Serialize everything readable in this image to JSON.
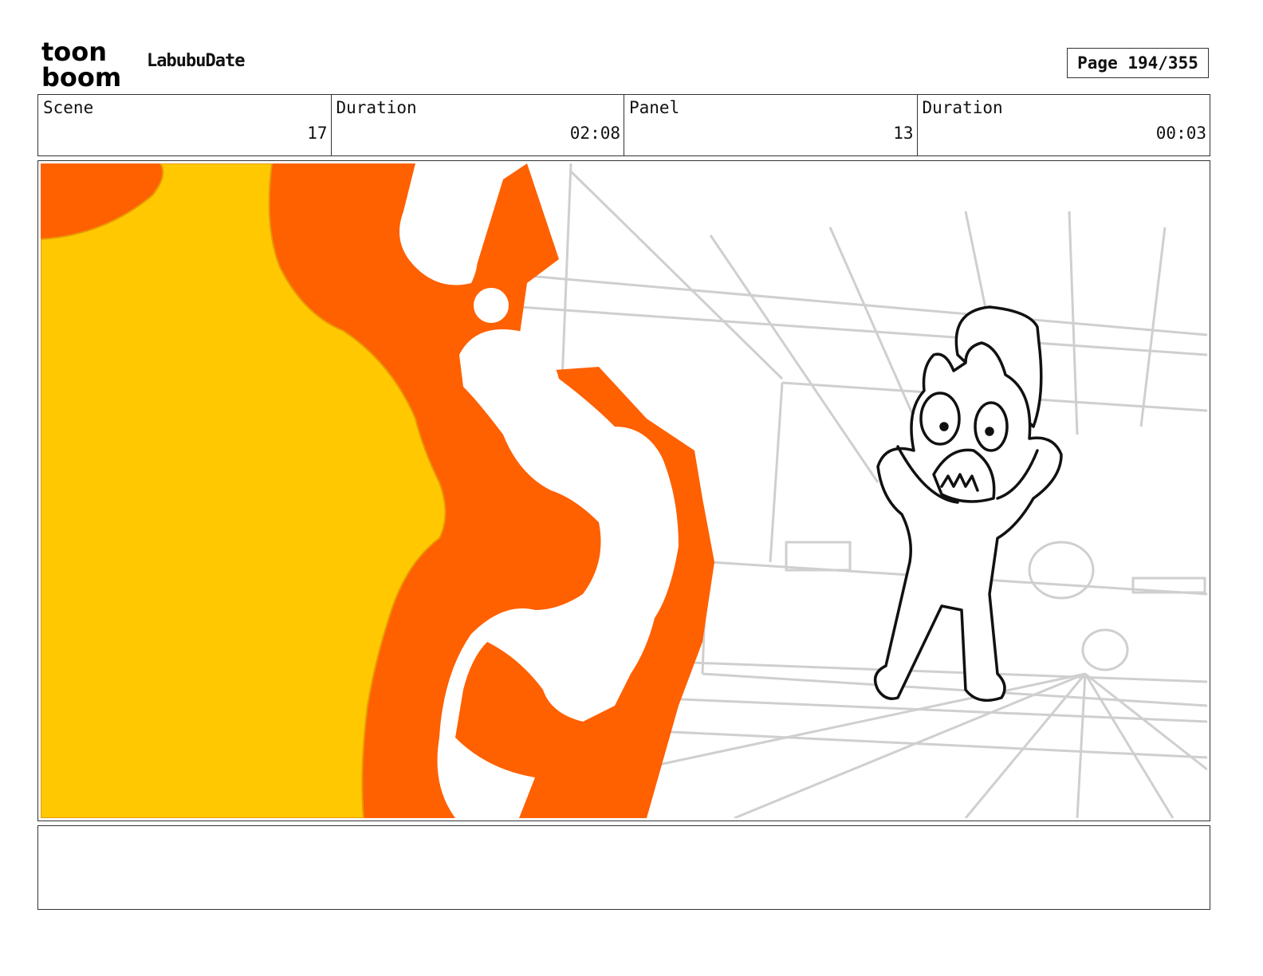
{
  "header": {
    "logo_line1": "toon",
    "logo_line2": "boom",
    "project_title": "LabubuDate",
    "page_label": "Page 194/355"
  },
  "info": [
    {
      "label": "Scene",
      "value": "17"
    },
    {
      "label": "Duration",
      "value": "02:08"
    },
    {
      "label": "Panel",
      "value": "13"
    },
    {
      "label": "Duration",
      "value": "00:03"
    }
  ],
  "notes": {
    "text": ""
  },
  "colors": {
    "explosion_yellow": "#FFC800",
    "explosion_orange": "#FF6000",
    "sketch_line": "#c8c8c8",
    "ink": "#111111"
  }
}
